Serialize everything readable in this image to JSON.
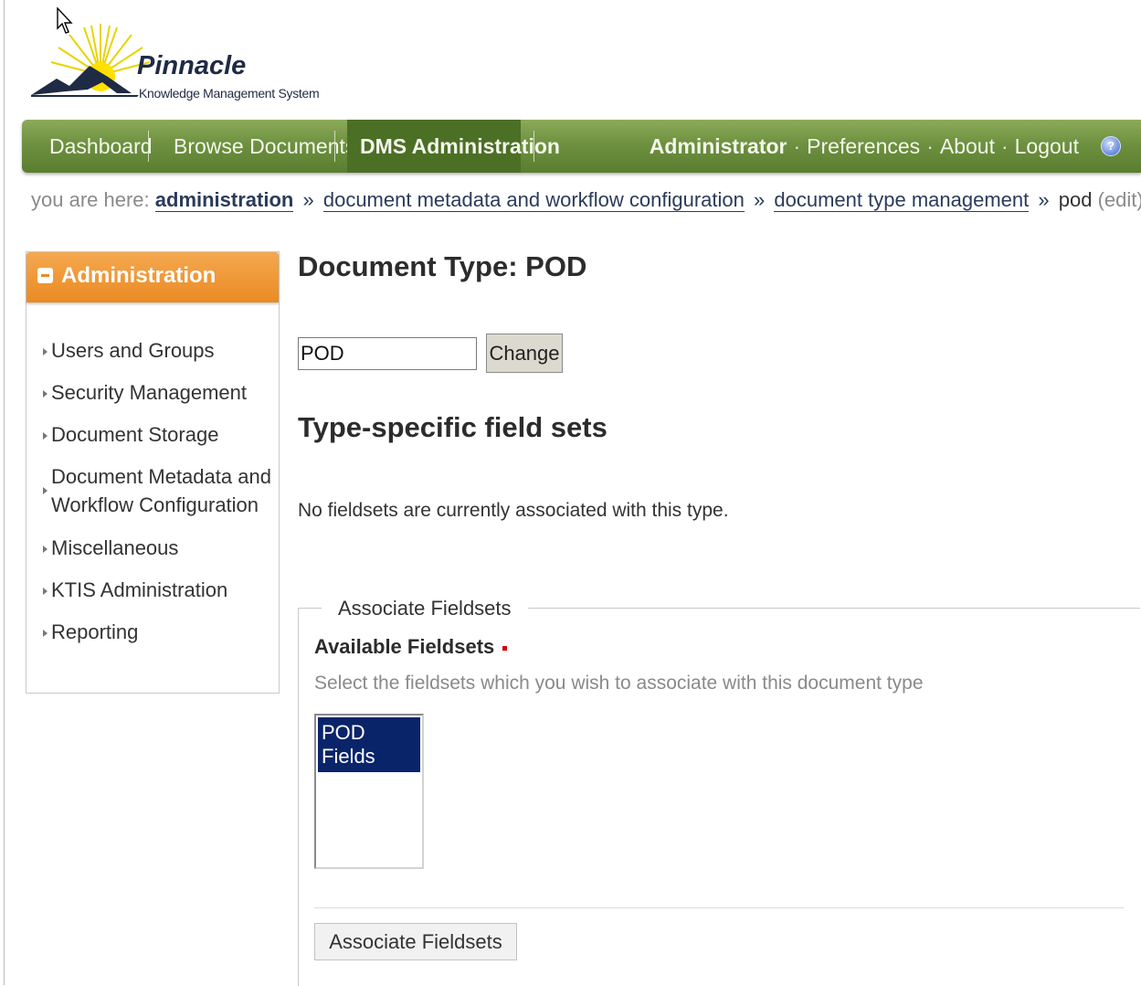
{
  "logo": {
    "name": "Pinnacle",
    "subtitle": "Knowledge Management System"
  },
  "nav": {
    "items": [
      "Dashboard",
      "Browse Documents",
      "DMS Administration"
    ],
    "active": "DMS Administration",
    "user": "Administrator",
    "links": [
      "Preferences",
      "About",
      "Logout"
    ],
    "help_icon": "help-icon"
  },
  "breadcrumb": {
    "prefix": "you are here:",
    "crumbs": [
      "administration",
      "document metadata and workflow configuration",
      "document type management"
    ],
    "separator": "»",
    "current": "pod",
    "edit": "(edit)"
  },
  "sidebar": {
    "title": "Administration",
    "items": [
      {
        "label": "Users and Groups"
      },
      {
        "label": "Security Management"
      },
      {
        "label": "Document Storage"
      },
      {
        "label_line1": "Document Metadata and",
        "label_line2": "Workflow Configuration"
      },
      {
        "label": "Miscellaneous"
      },
      {
        "label": "KTIS Administration"
      },
      {
        "label": "Reporting"
      }
    ]
  },
  "main": {
    "title": "Document Type: POD",
    "name_value": "POD",
    "change_label": "Change",
    "subtitle": "Type-specific field sets",
    "no_fieldsets": "No fieldsets are currently associated with this type.",
    "fieldset": {
      "legend": "Associate Fieldsets",
      "label": "Available Fieldsets",
      "help": "Select the fieldsets which you wish to associate with this document type",
      "options": [
        "POD Fields"
      ],
      "button": "Associate Fieldsets"
    }
  },
  "colors": {
    "nav_green": "#6e9140",
    "sidebar_orange": "#ea8a23",
    "selected_option": "#0a246a"
  }
}
